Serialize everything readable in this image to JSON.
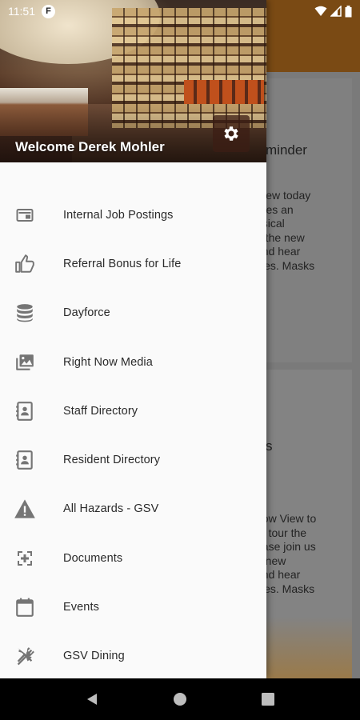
{
  "status_bar": {
    "time": "11:51",
    "notification_icon": "F"
  },
  "drawer": {
    "welcome_text": "Welcome Derek Mohler",
    "items": [
      {
        "label": "Internal Job Postings",
        "icon": "job-postings-icon"
      },
      {
        "label": "Referral Bonus for Life",
        "icon": "thumbs-up-icon"
      },
      {
        "label": "Dayforce",
        "icon": "database-icon"
      },
      {
        "label": "Right Now Media",
        "icon": "photo-library-icon"
      },
      {
        "label": "Staff Directory",
        "icon": "contact-book-icon"
      },
      {
        "label": "Resident Directory",
        "icon": "contact-book-icon"
      },
      {
        "label": "All Hazards - GSV",
        "icon": "warning-icon"
      },
      {
        "label": "Documents",
        "icon": "documents-icon"
      },
      {
        "label": "Events",
        "icon": "calendar-icon"
      },
      {
        "label": "GSV Dining",
        "icon": "dining-icon"
      }
    ]
  },
  "background": {
    "card1": {
      "title": "minder",
      "lines": [
        "View today",
        "rees an",
        "usical",
        "n the new",
        "and hear",
        "ives. Masks"
      ]
    },
    "card2": {
      "title": "s",
      "lines": [
        "dow View to",
        "to tour the",
        "ease join us",
        "e new",
        "and hear",
        "ives. Masks"
      ]
    }
  },
  "colors": {
    "app_bar": "#7a4a14",
    "drawer_bg": "#fafafa",
    "icon_gray": "#757575"
  }
}
